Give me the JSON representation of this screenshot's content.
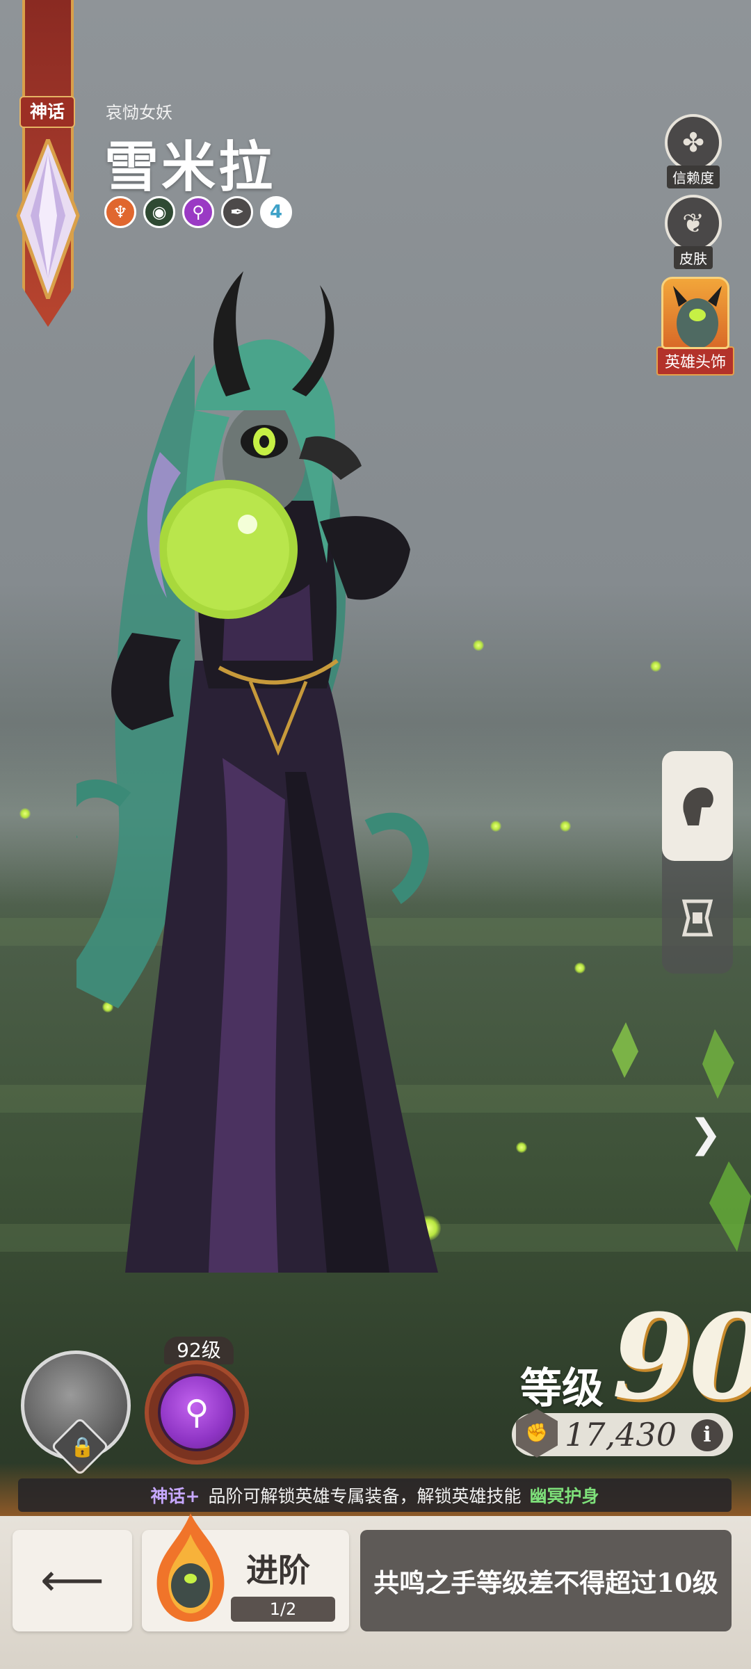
{
  "hero": {
    "rarity": "神话",
    "subtitle": "哀恸女妖",
    "name": "雪米拉",
    "traits": [
      {
        "icon": "trident-icon",
        "color": "#e0672f"
      },
      {
        "icon": "eye-icon",
        "color": "#2f4a33"
      },
      {
        "icon": "magnifier-icon",
        "color": "#9a3ac4"
      },
      {
        "icon": "feather-icon",
        "color": "#4d4a4a"
      },
      {
        "icon": "number-badge",
        "value": "4"
      }
    ]
  },
  "side_menu": {
    "trust_label": "信赖度",
    "skin_label": "皮肤",
    "headwear_label": "英雄头饰"
  },
  "equipment": {
    "skill_level": "92级"
  },
  "stats": {
    "level_label": "等级",
    "level_value": "90",
    "power_value": "17,430",
    "info_glyph": "i"
  },
  "info_bar": {
    "rank": "神话+",
    "text": "品阶可解锁英雄专属装备，解锁英雄技能",
    "skill": "幽冥护身"
  },
  "bottom": {
    "advance_label": "进阶",
    "advance_progress": "1/2",
    "resonance_note": "共鸣之手等级差不得超过10级"
  },
  "colors": {
    "accent_orange": "#e8782a",
    "rarity_red": "#9c2f24",
    "skill_purple": "#8f35c5",
    "info_green": "#7ee07a"
  }
}
